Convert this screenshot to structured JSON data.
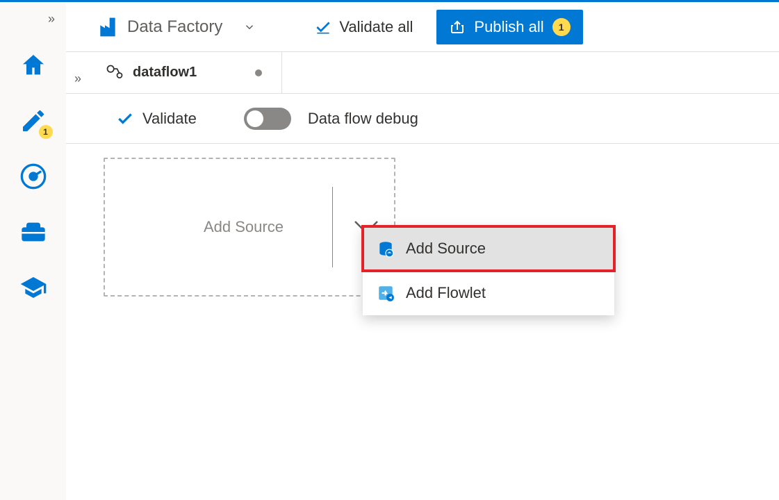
{
  "brand": {
    "name": "Data Factory"
  },
  "toolbar": {
    "validate_all_label": "Validate all",
    "publish_label": "Publish all",
    "publish_count": "1"
  },
  "rail": {
    "author_badge": "1"
  },
  "tab": {
    "title": "dataflow1"
  },
  "subtoolbar": {
    "validate_label": "Validate",
    "debug_label": "Data flow debug"
  },
  "canvas": {
    "add_source_label": "Add Source"
  },
  "dropdown": {
    "add_source": "Add Source",
    "add_flowlet": "Add Flowlet"
  }
}
